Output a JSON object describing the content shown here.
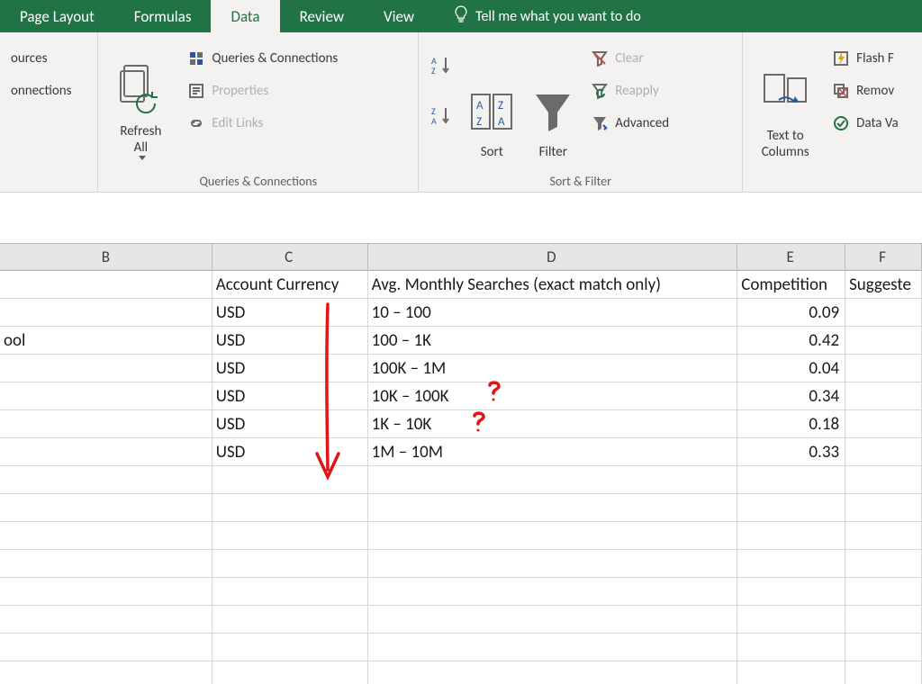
{
  "tabs": {
    "page_layout": "Page Layout",
    "formulas": "Formulas",
    "data": "Data",
    "review": "Review",
    "view": "View",
    "tell_me": "Tell me what you want to do"
  },
  "ribbon": {
    "group_get": {
      "btn_sources": "ources",
      "btn_connections": "onnections"
    },
    "group_qc": {
      "label": "Queries & Connections",
      "refresh_all": "Refresh\nAll",
      "queries": "Queries & Connections",
      "properties": "Properties",
      "edit_links": "Edit Links"
    },
    "group_sf": {
      "label": "Sort & Filter",
      "sort": "Sort",
      "filter": "Filter",
      "clear": "Clear",
      "reapply": "Reapply",
      "advanced": "Advanced"
    },
    "group_dt": {
      "text_to_columns": "Text to\nColumns",
      "flash_fill": "Flash F",
      "remove_dup": "Remov",
      "data_val": "Data Va"
    }
  },
  "columns": {
    "B": "B",
    "C": "C",
    "D": "D",
    "E": "E",
    "F": "F"
  },
  "headers": {
    "C": "Account Currency",
    "D": "Avg. Monthly Searches (exact match only)",
    "E": "Competition",
    "F": "Suggeste"
  },
  "rows": [
    {
      "B": "",
      "C": "USD",
      "D": "10 – 100",
      "E": "0.09"
    },
    {
      "B": "ool",
      "C": "USD",
      "D": "100 – 1K",
      "E": "0.42"
    },
    {
      "B": "",
      "C": "USD",
      "D": "100K – 1M",
      "E": "0.04"
    },
    {
      "B": "",
      "C": "USD",
      "D": "10K – 100K",
      "E": "0.34"
    },
    {
      "B": "",
      "C": "USD",
      "D": "1K – 10K",
      "E": "0.18"
    },
    {
      "B": "",
      "C": "USD",
      "D": "1M – 10M",
      "E": "0.33"
    }
  ],
  "chart_data": {
    "type": "table",
    "columns": [
      "Account Currency",
      "Avg. Monthly Searches (exact match only)",
      "Competition"
    ],
    "rows": [
      [
        "USD",
        "10 – 100",
        0.09
      ],
      [
        "USD",
        "100 – 1K",
        0.42
      ],
      [
        "USD",
        "100K – 1M",
        0.04
      ],
      [
        "USD",
        "10K – 100K",
        0.34
      ],
      [
        "USD",
        "1K – 10K",
        0.18
      ],
      [
        "USD",
        "1M – 10M",
        0.33
      ]
    ]
  }
}
